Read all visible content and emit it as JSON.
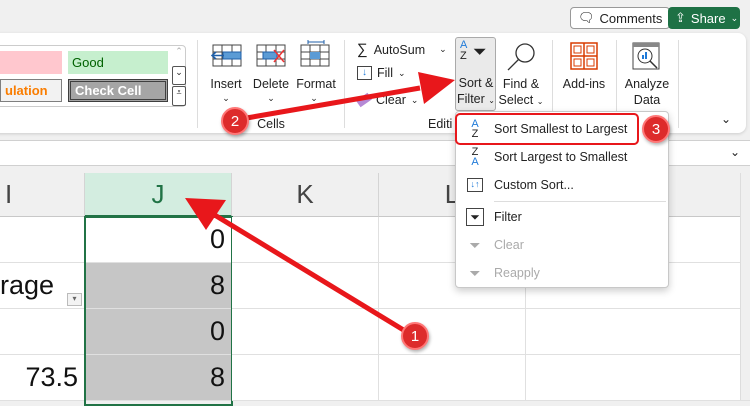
{
  "top": {
    "comments": "Comments",
    "share": "Share"
  },
  "styles": {
    "good": "Good",
    "calculation": "ulation",
    "check_cell": "Check Cell"
  },
  "cells_group": {
    "insert": "Insert",
    "delete": "Delete",
    "format": "Format",
    "label": "Cells"
  },
  "editing": {
    "autosum": "AutoSum",
    "fill": "Fill",
    "clear": "Clear",
    "sort_filter_1": "Sort &",
    "sort_filter_2": "Filter",
    "find_1": "Find &",
    "find_2": "Select",
    "label": "Editi"
  },
  "addins": "Add-ins",
  "analyze": {
    "line1": "Analyze",
    "line2": "Data"
  },
  "columns": [
    "I",
    "J",
    "K",
    "L"
  ],
  "cells": {
    "i2": "rage",
    "i4": "73.5",
    "j": [
      "0",
      "8",
      "0",
      "8"
    ]
  },
  "menu": [
    {
      "label": "Sort Smallest to Largest",
      "icon": "A-Z",
      "enabled": true
    },
    {
      "label": "Sort Largest to Smallest",
      "icon": "Z-A",
      "enabled": true
    },
    {
      "label": "Custom Sort...",
      "icon": "custom-sort",
      "enabled": true
    },
    {
      "label": "Filter",
      "icon": "filter",
      "enabled": true
    },
    {
      "label": "Clear",
      "icon": "clear-filter",
      "enabled": false
    },
    {
      "label": "Reapply",
      "icon": "reapply",
      "enabled": false
    }
  ],
  "badges": [
    "1",
    "2",
    "3"
  ],
  "colors": {
    "accent": "#217346",
    "annotation": "#e8171b",
    "selected_header": "#d3ede0"
  }
}
